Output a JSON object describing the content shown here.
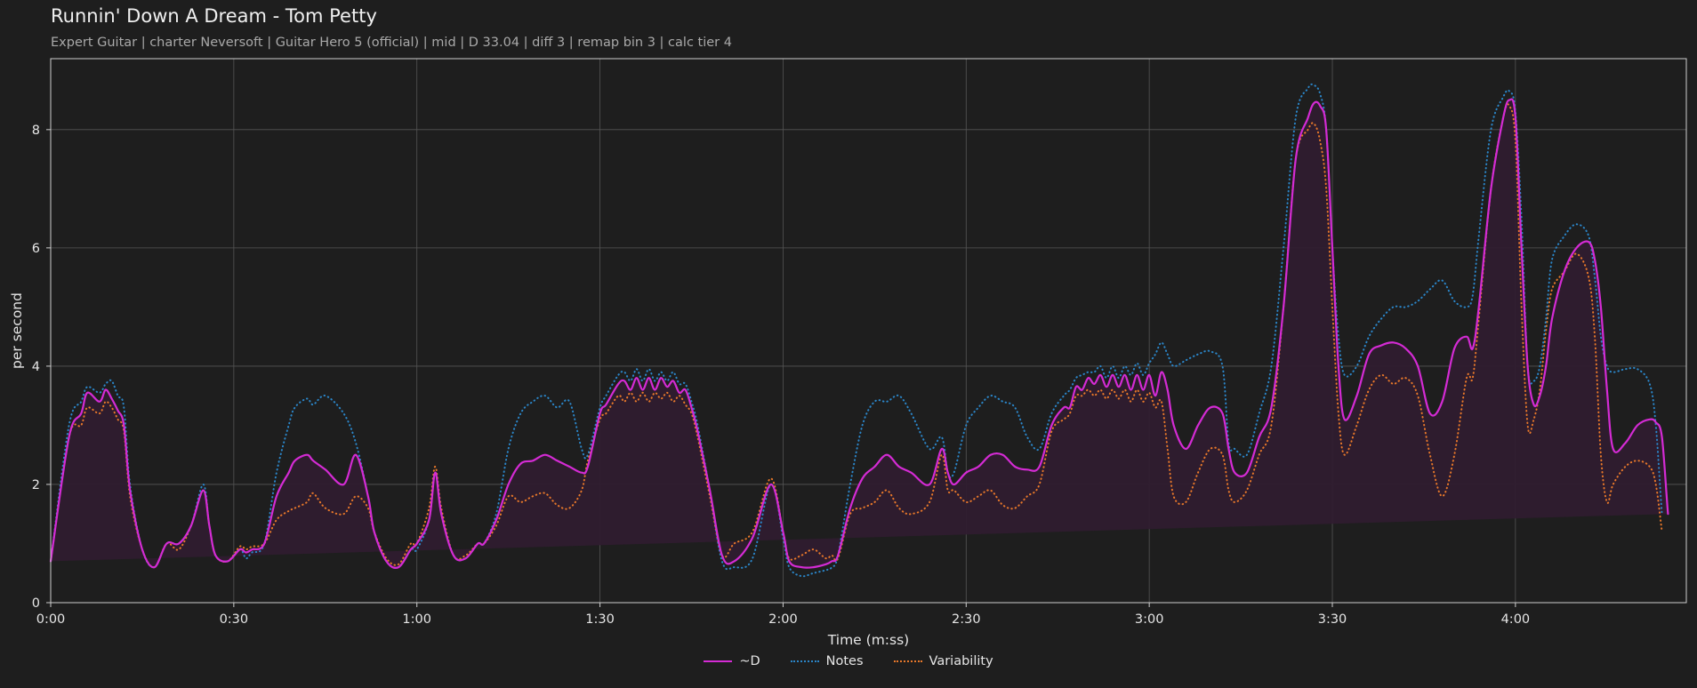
{
  "header": {
    "title": "Runnin' Down A Dream - Tom Petty",
    "subtitle": "Expert Guitar  |  charter Neversoft  |  Guitar Hero 5 (official)  |  mid  |  D 33.04  |  diff 3  |  remap bin 3  |  calc tier 4"
  },
  "colors": {
    "background": "#1e1e1e",
    "d_line": "#d42bd4",
    "d_fill": "#2f1c2f",
    "notes": "#2b86c9",
    "variability": "#e8782a",
    "grid": "#555555",
    "axis": "#cfcfcf"
  },
  "chart_data": {
    "type": "line",
    "title": "Runnin' Down A Dream - Tom Petty",
    "xlabel": "Time (m:ss)",
    "ylabel": "per second",
    "xlim": [
      0,
      268
    ],
    "ylim": [
      0,
      9.2
    ],
    "x_ticks": [
      0,
      30,
      60,
      90,
      120,
      150,
      180,
      210,
      240
    ],
    "x_tick_labels": [
      "0:00",
      "0:30",
      "1:00",
      "1:30",
      "2:00",
      "2:30",
      "3:00",
      "3:30",
      "4:00"
    ],
    "y_ticks": [
      0,
      2,
      4,
      6,
      8
    ],
    "y_tick_labels": [
      "0",
      "2",
      "4",
      "6",
      "8"
    ],
    "grid": true,
    "legend_position": "bottom-center",
    "x": [
      0,
      3,
      5,
      6,
      8,
      9,
      10,
      11,
      12,
      13,
      15,
      17,
      19,
      21,
      23,
      25,
      26,
      27,
      29,
      31,
      32,
      33,
      35,
      37,
      39,
      40,
      42,
      43,
      45,
      48,
      50,
      52,
      53,
      55,
      57,
      59,
      60,
      62,
      63,
      64,
      66,
      68,
      70,
      71,
      73,
      75,
      77,
      79,
      81,
      83,
      85,
      87,
      88,
      90,
      91,
      93,
      94,
      95,
      96,
      97,
      98,
      99,
      100,
      101,
      102,
      103,
      104,
      105,
      106,
      108,
      110,
      112,
      115,
      118,
      120,
      121,
      123,
      125,
      127,
      128,
      129,
      131,
      133,
      135,
      137,
      139,
      141,
      144,
      146,
      147,
      148,
      150,
      152,
      154,
      156,
      158,
      160,
      162,
      164,
      166,
      167,
      168,
      169,
      170,
      171,
      172,
      173,
      174,
      175,
      176,
      177,
      178,
      179,
      180,
      181,
      182,
      183,
      184,
      186,
      188,
      190,
      192,
      193,
      194,
      196,
      198,
      200,
      202,
      204,
      206,
      207,
      208,
      209,
      210,
      211,
      212,
      214,
      216,
      218,
      220,
      222,
      224,
      226,
      228,
      230,
      232,
      233,
      234,
      236,
      238,
      239,
      240,
      241,
      242,
      243,
      244,
      245,
      246,
      248,
      250,
      252,
      253,
      254,
      255,
      256,
      258,
      260,
      262,
      263,
      264,
      265,
      266,
      267,
      268
    ],
    "series": [
      {
        "name": "~D",
        "style": "solid",
        "values": [
          0.7,
          2.8,
          3.2,
          3.55,
          3.4,
          3.6,
          3.45,
          3.25,
          3.0,
          1.9,
          0.9,
          0.6,
          1.0,
          1.0,
          1.3,
          1.9,
          1.3,
          0.8,
          0.7,
          0.9,
          0.85,
          0.9,
          1.0,
          1.8,
          2.2,
          2.4,
          2.5,
          2.4,
          2.25,
          2.0,
          2.5,
          1.8,
          1.2,
          0.7,
          0.6,
          0.9,
          1.0,
          1.4,
          2.2,
          1.5,
          0.8,
          0.75,
          1.0,
          1.0,
          1.4,
          2.0,
          2.35,
          2.4,
          2.5,
          2.4,
          2.3,
          2.2,
          2.3,
          3.2,
          3.35,
          3.7,
          3.75,
          3.6,
          3.8,
          3.6,
          3.8,
          3.6,
          3.8,
          3.65,
          3.75,
          3.55,
          3.6,
          3.3,
          2.9,
          1.9,
          0.8,
          0.7,
          1.1,
          2.0,
          1.2,
          0.7,
          0.6,
          0.6,
          0.65,
          0.7,
          0.8,
          1.6,
          2.1,
          2.3,
          2.5,
          2.3,
          2.2,
          2.0,
          2.6,
          2.2,
          2.0,
          2.2,
          2.3,
          2.5,
          2.5,
          2.3,
          2.25,
          2.3,
          3.0,
          3.3,
          3.3,
          3.65,
          3.6,
          3.8,
          3.7,
          3.85,
          3.65,
          3.85,
          3.65,
          3.85,
          3.6,
          3.85,
          3.6,
          3.85,
          3.5,
          3.9,
          3.6,
          3.0,
          2.6,
          3.0,
          3.3,
          3.2,
          2.6,
          2.2,
          2.2,
          2.8,
          3.3,
          5.0,
          7.5,
          8.2,
          8.45,
          8.4,
          8.0,
          6.0,
          4.0,
          3.1,
          3.5,
          4.2,
          4.35,
          4.4,
          4.3,
          4.0,
          3.2,
          3.4,
          4.3,
          4.5,
          4.3,
          5.0,
          7.0,
          8.2,
          8.5,
          8.2,
          6.0,
          4.0,
          3.35,
          3.5,
          4.0,
          4.8,
          5.6,
          6.0,
          6.1,
          5.8,
          5.0,
          3.6,
          2.6,
          2.7,
          3.0,
          3.1,
          3.05,
          2.8,
          1.5,
          0.3
        ]
      },
      {
        "name": "Notes",
        "style": "dotted",
        "values": [
          0.7,
          3.0,
          3.4,
          3.65,
          3.55,
          3.7,
          3.75,
          3.5,
          3.3,
          2.0,
          0.9,
          0.6,
          1.0,
          1.0,
          1.3,
          2.0,
          1.3,
          0.8,
          0.7,
          0.9,
          0.75,
          0.85,
          1.0,
          2.2,
          3.0,
          3.3,
          3.45,
          3.35,
          3.5,
          3.2,
          2.7,
          1.8,
          1.2,
          0.7,
          0.6,
          0.9,
          0.9,
          1.4,
          2.2,
          1.5,
          0.8,
          0.75,
          1.0,
          1.0,
          1.5,
          2.6,
          3.2,
          3.4,
          3.5,
          3.3,
          3.4,
          2.6,
          2.5,
          3.3,
          3.5,
          3.85,
          3.9,
          3.75,
          3.95,
          3.75,
          3.95,
          3.75,
          3.9,
          3.75,
          3.9,
          3.7,
          3.7,
          3.4,
          3.0,
          1.9,
          0.7,
          0.6,
          0.75,
          2.0,
          1.1,
          0.6,
          0.45,
          0.5,
          0.55,
          0.6,
          0.8,
          2.0,
          3.0,
          3.4,
          3.4,
          3.5,
          3.2,
          2.6,
          2.8,
          2.2,
          2.2,
          3.0,
          3.3,
          3.5,
          3.4,
          3.3,
          2.8,
          2.6,
          3.2,
          3.5,
          3.6,
          3.8,
          3.85,
          3.9,
          3.9,
          4.0,
          3.8,
          4.0,
          3.8,
          4.0,
          3.85,
          4.05,
          3.85,
          4.05,
          4.2,
          4.4,
          4.2,
          4.0,
          4.1,
          4.2,
          4.25,
          4.0,
          2.7,
          2.6,
          2.5,
          3.2,
          4.0,
          6.0,
          8.2,
          8.7,
          8.75,
          8.6,
          8.0,
          6.0,
          4.5,
          3.85,
          4.0,
          4.5,
          4.8,
          5.0,
          5.0,
          5.1,
          5.3,
          5.45,
          5.1,
          5.0,
          5.2,
          6.2,
          8.0,
          8.55,
          8.65,
          8.3,
          6.5,
          4.0,
          3.75,
          4.0,
          4.8,
          5.8,
          6.2,
          6.4,
          6.2,
          5.5,
          4.5,
          4.0,
          3.9,
          3.95,
          3.95,
          3.7,
          3.0,
          1.5,
          0.3
        ]
      },
      {
        "name": "Variability",
        "style": "dotted",
        "values": [
          0.7,
          2.8,
          3.0,
          3.3,
          3.2,
          3.4,
          3.3,
          3.1,
          2.9,
          1.8,
          0.9,
          0.6,
          1.0,
          0.9,
          1.3,
          1.9,
          1.3,
          0.8,
          0.7,
          0.95,
          0.9,
          0.95,
          1.0,
          1.4,
          1.55,
          1.6,
          1.7,
          1.85,
          1.6,
          1.5,
          1.8,
          1.6,
          1.2,
          0.75,
          0.65,
          1.0,
          1.0,
          1.6,
          2.3,
          1.6,
          0.8,
          0.8,
          1.0,
          1.0,
          1.3,
          1.8,
          1.7,
          1.8,
          1.85,
          1.65,
          1.6,
          1.9,
          2.4,
          3.1,
          3.2,
          3.5,
          3.4,
          3.55,
          3.4,
          3.55,
          3.4,
          3.55,
          3.45,
          3.55,
          3.4,
          3.5,
          3.35,
          3.2,
          2.8,
          1.8,
          0.8,
          1.0,
          1.2,
          2.1,
          1.2,
          0.75,
          0.8,
          0.9,
          0.75,
          0.8,
          0.75,
          1.5,
          1.6,
          1.7,
          1.9,
          1.6,
          1.5,
          1.7,
          2.5,
          1.9,
          1.9,
          1.7,
          1.8,
          1.9,
          1.65,
          1.6,
          1.8,
          2.0,
          2.9,
          3.1,
          3.2,
          3.5,
          3.5,
          3.6,
          3.5,
          3.6,
          3.45,
          3.6,
          3.45,
          3.6,
          3.4,
          3.6,
          3.4,
          3.55,
          3.3,
          3.4,
          2.6,
          1.8,
          1.7,
          2.2,
          2.6,
          2.5,
          1.9,
          1.7,
          1.9,
          2.5,
          3.0,
          5.0,
          7.5,
          8.0,
          8.1,
          7.8,
          7.0,
          5.0,
          3.2,
          2.5,
          3.0,
          3.6,
          3.85,
          3.7,
          3.8,
          3.5,
          2.5,
          1.8,
          2.5,
          3.8,
          3.8,
          4.8,
          7.0,
          8.2,
          8.4,
          7.8,
          5.0,
          3.0,
          3.1,
          3.6,
          4.6,
          5.3,
          5.6,
          5.9,
          5.5,
          4.5,
          2.5,
          1.7,
          2.0,
          2.3,
          2.4,
          2.3,
          2.0,
          1.2,
          0.3
        ]
      }
    ]
  }
}
